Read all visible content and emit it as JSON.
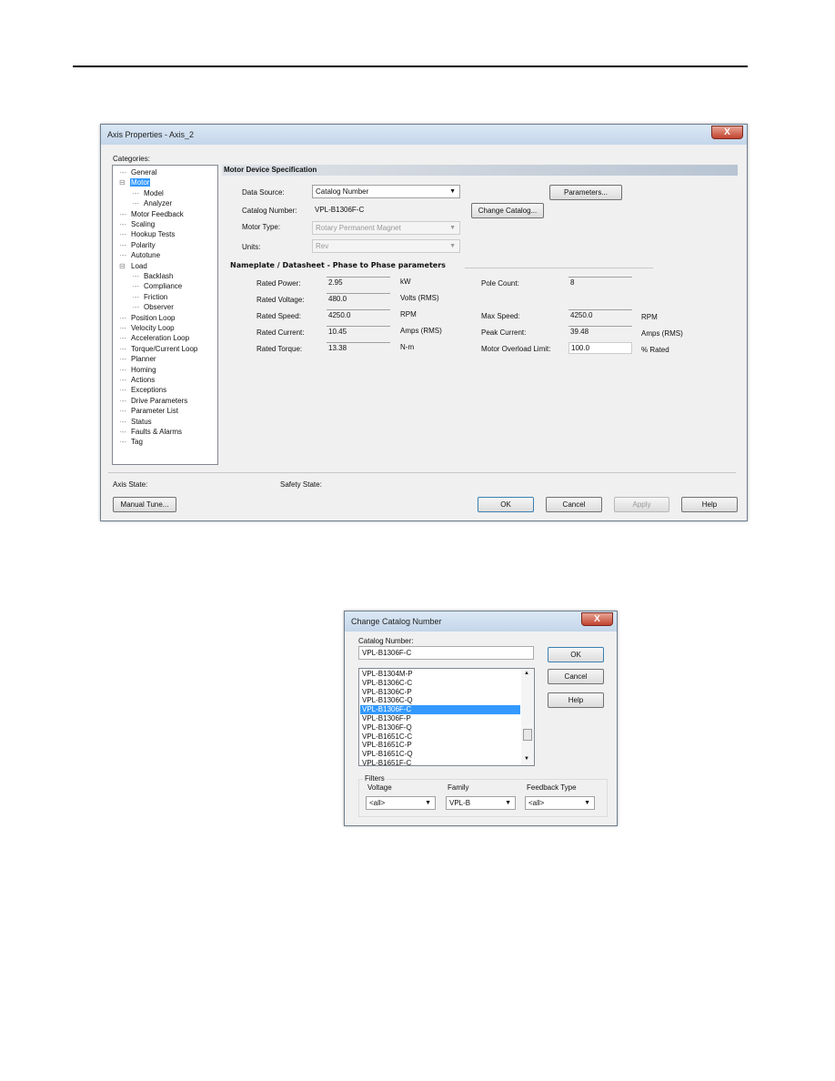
{
  "axis_dialog": {
    "title": "Axis Properties - Axis_2",
    "close": "X",
    "categories_label": "Categories:",
    "tree": [
      "General",
      "Motor",
      "Model",
      "Analyzer",
      "Motor Feedback",
      "Scaling",
      "Hookup Tests",
      "Polarity",
      "Autotune",
      "Load",
      "Backlash",
      "Compliance",
      "Friction",
      "Observer",
      "Position Loop",
      "Velocity Loop",
      "Acceleration Loop",
      "Torque/Current Loop",
      "Planner",
      "Homing",
      "Actions",
      "Exceptions",
      "Drive Parameters",
      "Parameter List",
      "Status",
      "Faults & Alarms",
      "Tag"
    ],
    "selected_item": "Motor",
    "section_title": "Motor Device Specification",
    "data_source_label": "Data Source:",
    "data_source": "Catalog Number",
    "catalog_label": "Catalog Number:",
    "catalog": "VPL-B1306F-C",
    "motor_type_label": "Motor Type:",
    "motor_type": "Rotary Permanent Magnet",
    "units_label": "Units:",
    "units": "Rev",
    "parameters_btn": "Parameters...",
    "change_catalog_btn": "Change Catalog...",
    "nameplate_title": "Nameplate / Datasheet - Phase to Phase parameters",
    "left_params": [
      {
        "label": "Rated Power:",
        "value": "2.95",
        "unit": "kW"
      },
      {
        "label": "Rated Voltage:",
        "value": "480.0",
        "unit": "Volts (RMS)"
      },
      {
        "label": "Rated Speed:",
        "value": "4250.0",
        "unit": "RPM"
      },
      {
        "label": "Rated Current:",
        "value": "10.45",
        "unit": "Amps (RMS)"
      },
      {
        "label": "Rated Torque:",
        "value": "13.38",
        "unit": "N-m"
      }
    ],
    "right_params": [
      {
        "label": "Pole Count:",
        "value": "8",
        "unit": ""
      },
      {
        "label": "Max Speed:",
        "value": "4250.0",
        "unit": "RPM"
      },
      {
        "label": "Peak Current:",
        "value": "39.48",
        "unit": "Amps (RMS)"
      },
      {
        "label": "Motor Overload Limit:",
        "value": "100.0",
        "unit": "% Rated"
      }
    ],
    "axis_state_label": "Axis State:",
    "safety_state_label": "Safety State:",
    "buttons": {
      "manual_tune": "Manual Tune...",
      "ok": "OK",
      "cancel": "Cancel",
      "apply": "Apply",
      "help": "Help"
    }
  },
  "catalog_dialog": {
    "title": "Change Catalog Number",
    "close": "X",
    "catalog_label": "Catalog Number:",
    "catalog_value": "VPL-B1306F-C",
    "list": [
      "VPL-B1304M-P",
      "VPL-B1306C-C",
      "VPL-B1306C-P",
      "VPL-B1306C-Q",
      "VPL-B1306F-C",
      "VPL-B1306F-P",
      "VPL-B1306F-Q",
      "VPL-B1651C-C",
      "VPL-B1651C-P",
      "VPL-B1651C-Q",
      "VPL-B1651F-C"
    ],
    "selected": "VPL-B1306F-C",
    "buttons": {
      "ok": "OK",
      "cancel": "Cancel",
      "help": "Help"
    },
    "filters_label": "Filters",
    "filters": [
      {
        "label": "Voltage",
        "value": "<all>"
      },
      {
        "label": "Family",
        "value": "VPL-B"
      },
      {
        "label": "Feedback Type",
        "value": "<all>"
      }
    ]
  },
  "colors": {
    "selection": "#3399ff",
    "title_bar": "#c4d6ea",
    "close": "#c2432e"
  }
}
